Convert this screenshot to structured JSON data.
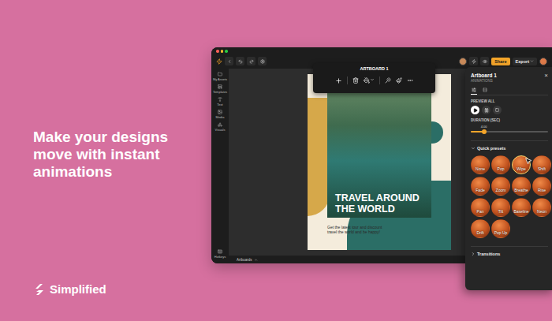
{
  "promo": {
    "headline": "Make your designs move with instant animations",
    "brand": "Simplified"
  },
  "header": {
    "share": "Share",
    "export": "Export"
  },
  "sidebar": {
    "items": [
      {
        "label": "My Assets"
      },
      {
        "label": "Templates"
      },
      {
        "label": "Text"
      },
      {
        "label": "Media"
      },
      {
        "label": "Visuals"
      }
    ],
    "footer": "Hotkeys"
  },
  "bottom_bar": {
    "label": "Artboards"
  },
  "artboard_toolbar": {
    "title": "ARTBOARD 1"
  },
  "design": {
    "headline_lines": [
      "TRAVEL AROUND",
      "THE WORLD"
    ],
    "body": "Get the latest tour and discount travel the world and be happy!"
  },
  "panel": {
    "title": "Artboard 1",
    "subtitle": "ANIMATIONS",
    "close": "×",
    "tabs": [
      {
        "selected": true
      },
      {
        "selected": false
      }
    ],
    "preview_label": "PREVIEW ALL",
    "duration": {
      "label": "DURATION (SEC)",
      "reading": "4.00",
      "level": 0.17
    },
    "presets": {
      "label": "Quick presets",
      "expanded": true,
      "items": [
        {
          "label": "None",
          "selected": false
        },
        {
          "label": "Pop",
          "selected": false
        },
        {
          "label": "Wipe",
          "selected": true
        },
        {
          "label": "Shift",
          "selected": false
        },
        {
          "label": "Fade",
          "selected": false
        },
        {
          "label": "Zoom",
          "selected": false
        },
        {
          "label": "Breathe",
          "selected": false
        },
        {
          "label": "Rise",
          "selected": false
        },
        {
          "label": "Pan",
          "selected": false
        },
        {
          "label": "Tilt",
          "selected": false
        },
        {
          "label": "Baseline",
          "selected": false
        },
        {
          "label": "Neon",
          "selected": false
        },
        {
          "label": "Drift",
          "selected": false
        },
        {
          "label": "Pop Up",
          "selected": false
        }
      ]
    },
    "transitions": {
      "label": "Transitions",
      "expanded": false
    }
  }
}
